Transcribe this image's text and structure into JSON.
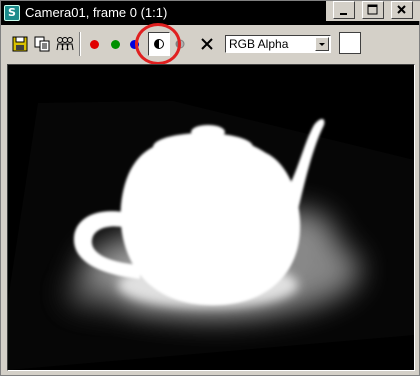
{
  "window": {
    "title": "Camera01, frame 0 (1:1)",
    "app_icon_glyph": "S",
    "controls": [
      "minimize-icon",
      "maximize-icon",
      "close-icon"
    ]
  },
  "toolbar": {
    "buttons": [
      {
        "name": "save-bitmap-button",
        "icon": "floppy-disk-icon"
      },
      {
        "name": "clone-window-button",
        "icon": "clone-icon"
      },
      {
        "name": "multiple-windows-button",
        "icon": "people-icon"
      },
      {
        "name": "red-channel-toggle",
        "color": "#e00000"
      },
      {
        "name": "green-channel-toggle",
        "color": "#009000"
      },
      {
        "name": "blue-channel-toggle",
        "color": "#0000e0"
      },
      {
        "name": "display-alpha-toggle",
        "icon": "half-circle-icon",
        "pressed": true
      },
      {
        "name": "monochrome-toggle",
        "icon": "half-circle-icon"
      },
      {
        "name": "clear-button",
        "icon": "x-icon"
      }
    ],
    "channel_select": {
      "value": "RGB Alpha"
    },
    "color_swatch": "#ffffff",
    "highlight_color": "#e02020"
  }
}
